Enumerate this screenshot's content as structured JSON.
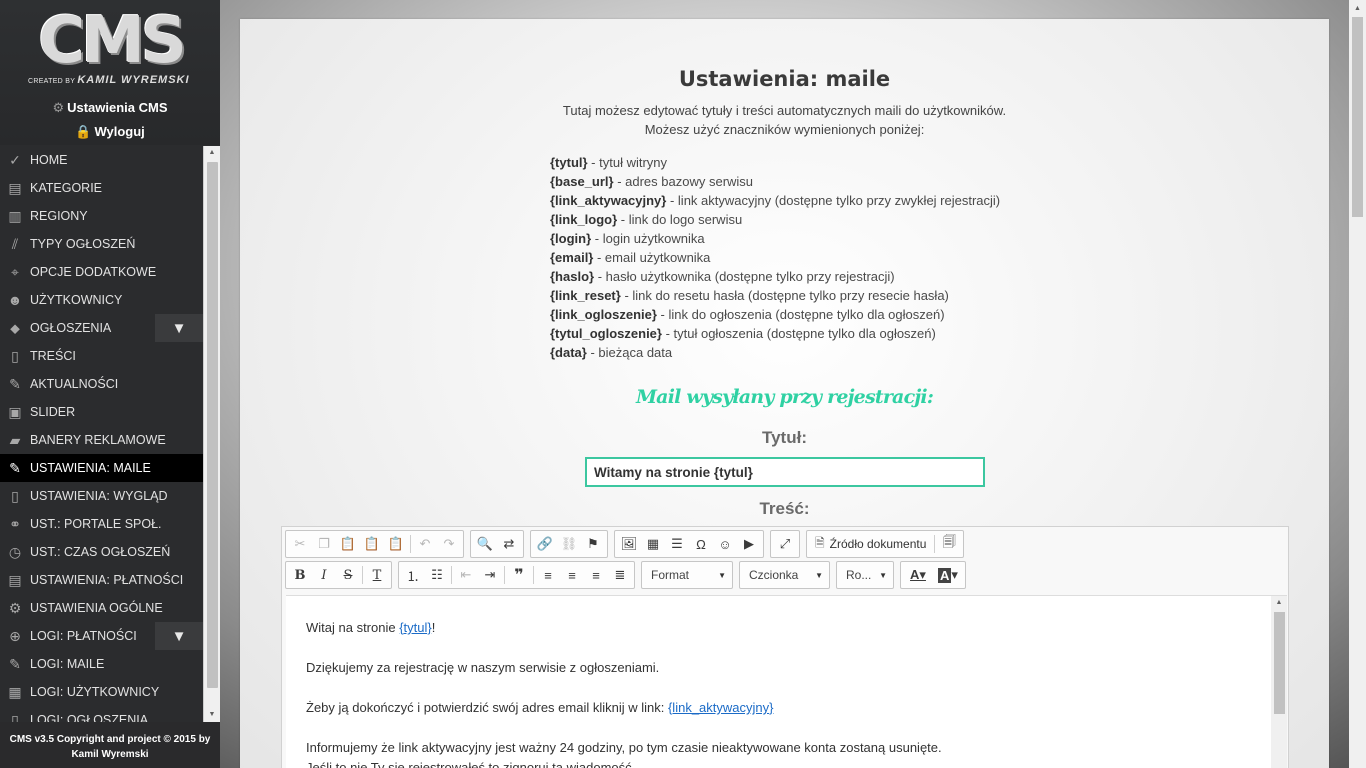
{
  "branding": {
    "logo_text": "CMS",
    "logo_credit_prefix": "CREATED BY",
    "logo_credit_name": "KAMIL WYREMSKI"
  },
  "top_links": {
    "settings": "Ustawienia CMS",
    "logout": "Wyloguj"
  },
  "menu": {
    "items": [
      {
        "label": "HOME",
        "icon": "check-circle-icon"
      },
      {
        "label": "KATEGORIE",
        "icon": "book-icon"
      },
      {
        "label": "REGIONY",
        "icon": "columns-icon"
      },
      {
        "label": "TYPY OGŁOSZEŃ",
        "icon": "slashes-icon"
      },
      {
        "label": "OPCJE DODATKOWE",
        "icon": "location-pin-icon"
      },
      {
        "label": "UŻYTKOWNICY",
        "icon": "user-face-icon"
      },
      {
        "label": "OGŁOSZENIA",
        "icon": "tag-icon",
        "expandable": true
      },
      {
        "label": "TREŚCI",
        "icon": "document-icon"
      },
      {
        "label": "AKTUALNOŚCI",
        "icon": "edit-icon"
      },
      {
        "label": "SLIDER",
        "icon": "picture-icon"
      },
      {
        "label": "BANERY REKLAMOWE",
        "icon": "folder-icon"
      },
      {
        "label": "USTAWIENIA: MAILE",
        "icon": "edit-icon",
        "active": true
      },
      {
        "label": "USTAWIENIA: WYGLĄD",
        "icon": "phone-icon"
      },
      {
        "label": "UST.: PORTALE SPOŁ.",
        "icon": "link-icon"
      },
      {
        "label": "UST.: CZAS OGŁOSZEŃ",
        "icon": "clock-icon"
      },
      {
        "label": "USTAWIENIA: PŁATNOŚCI",
        "icon": "database-icon"
      },
      {
        "label": "USTAWIENIA OGÓLNE",
        "icon": "gear-icon"
      },
      {
        "label": "LOGI: PŁATNOŚCI",
        "icon": "lock-icon",
        "expandable": true
      },
      {
        "label": "LOGI: MAILE",
        "icon": "edit-icon"
      },
      {
        "label": "LOGI: UŻYTKOWNICY",
        "icon": "calendar-icon"
      },
      {
        "label": "LOGI: OGŁOSZENIA",
        "icon": "document-icon"
      }
    ]
  },
  "footer": {
    "line1": "CMS v3.5 Copyright and project © 2015 by",
    "line2": "Kamil Wyremski"
  },
  "page": {
    "title": "Ustawienia: maile",
    "intro_line1": "Tutaj możesz edytować tytuły i treści automatycznych maili do użytkowników.",
    "intro_line2": "Możesz użyć znaczników wymienionych poniżej:",
    "tags": [
      {
        "tag": "{tytul}",
        "desc": " - tytuł witryny"
      },
      {
        "tag": "{base_url}",
        "desc": " - adres bazowy serwisu"
      },
      {
        "tag": "{link_aktywacyjny}",
        "desc": " - link aktywacyjny (dostępne tylko przy zwykłej rejestracji)"
      },
      {
        "tag": "{link_logo}",
        "desc": " - link do logo serwisu"
      },
      {
        "tag": "{login}",
        "desc": " - login użytkownika"
      },
      {
        "tag": "{email}",
        "desc": " - email użytkownika"
      },
      {
        "tag": "{haslo}",
        "desc": " - hasło użytkownika (dostępne tylko przy rejestracji)"
      },
      {
        "tag": "{link_reset}",
        "desc": " - link do resetu hasła (dostępne tylko przy resecie hasła)"
      },
      {
        "tag": "{link_ogloszenie}",
        "desc": " - link do ogłoszenia (dostępne tylko dla ogłoszeń)"
      },
      {
        "tag": "{tytul_ogloszenie}",
        "desc": " - tytuł ogłoszenia (dostępne tylko dla ogłoszeń)"
      },
      {
        "tag": "{data}",
        "desc": " - bieżąca data"
      }
    ],
    "section_heading": "Mail wysyłany przy rejestracji:",
    "title_label": "Tytuł:",
    "title_value": "Witamy na stronie {tytul}",
    "content_label": "Treść:"
  },
  "editor": {
    "source_label": "Źródło dokumentu",
    "format_label": "Format",
    "font_label": "Czcionka",
    "size_label": "Ro...",
    "body": {
      "p1_before": "Witaj na stronie ",
      "p1_tag": "{tytul}",
      "p1_after": "!",
      "p2": "Dziękujemy za rejestrację w naszym serwisie z ogłoszeniami.",
      "p3_before": "Żeby ją dokończyć i potwierdzić swój adres email kliknij w link: ",
      "p3_tag": "{link_aktywacyjny}",
      "p4": "Informujemy że link aktywacyjny jest ważny 24 godziny, po tym czasie nieaktywowane konta zostaną usunięte.",
      "p5": "Jeśli to nie Ty się rejestrowałeś to zignoruj tą wiadomość."
    }
  },
  "colors": {
    "accent": "#2fd1a3",
    "sidebar_bg": "#2b2c2e",
    "active_item_bg": "#000000",
    "link": "#1b6bc7"
  }
}
